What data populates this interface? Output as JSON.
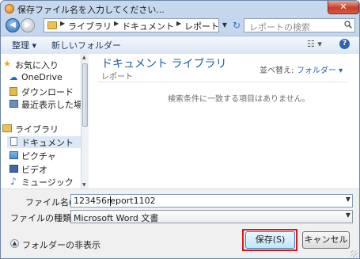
{
  "window": {
    "title": "保存ファイル名を入力してください...",
    "close_label": "✕"
  },
  "address": {
    "crumbs": [
      "ライブラリ",
      "ドキュメント",
      "レポート"
    ],
    "search_placeholder": "レポートの検索"
  },
  "toolbar": {
    "organize": "整理 ▾",
    "new_folder": "新しいフォルダー",
    "view": "☷ ▾",
    "help": "?"
  },
  "nav": {
    "favorites": "お気に入り",
    "onedrive": "OneDrive",
    "downloads": "ダウンロード",
    "recent": "最近表示した場所",
    "libraries": "ライブラリ",
    "documents": "ドキュメント",
    "pictures": "ピクチャ",
    "videos": "ビデオ",
    "music": "ミュージック"
  },
  "content": {
    "library_title": "ドキュメント ライブラリ",
    "library_sub": "レポート",
    "arrange_label": "並べ替え:",
    "arrange_value": "フォルダー ▾",
    "empty_message": "検索条件に一致する項目はありません。"
  },
  "form": {
    "filename_label": "ファイル名(N):",
    "filename_value": "123456report1102",
    "filetype_label": "ファイルの種類(T):",
    "filetype_value": "Microsoft Word 文書",
    "hide_folders": "フォルダーの非表示",
    "save": "保存(S)",
    "cancel": "キャンセル"
  }
}
